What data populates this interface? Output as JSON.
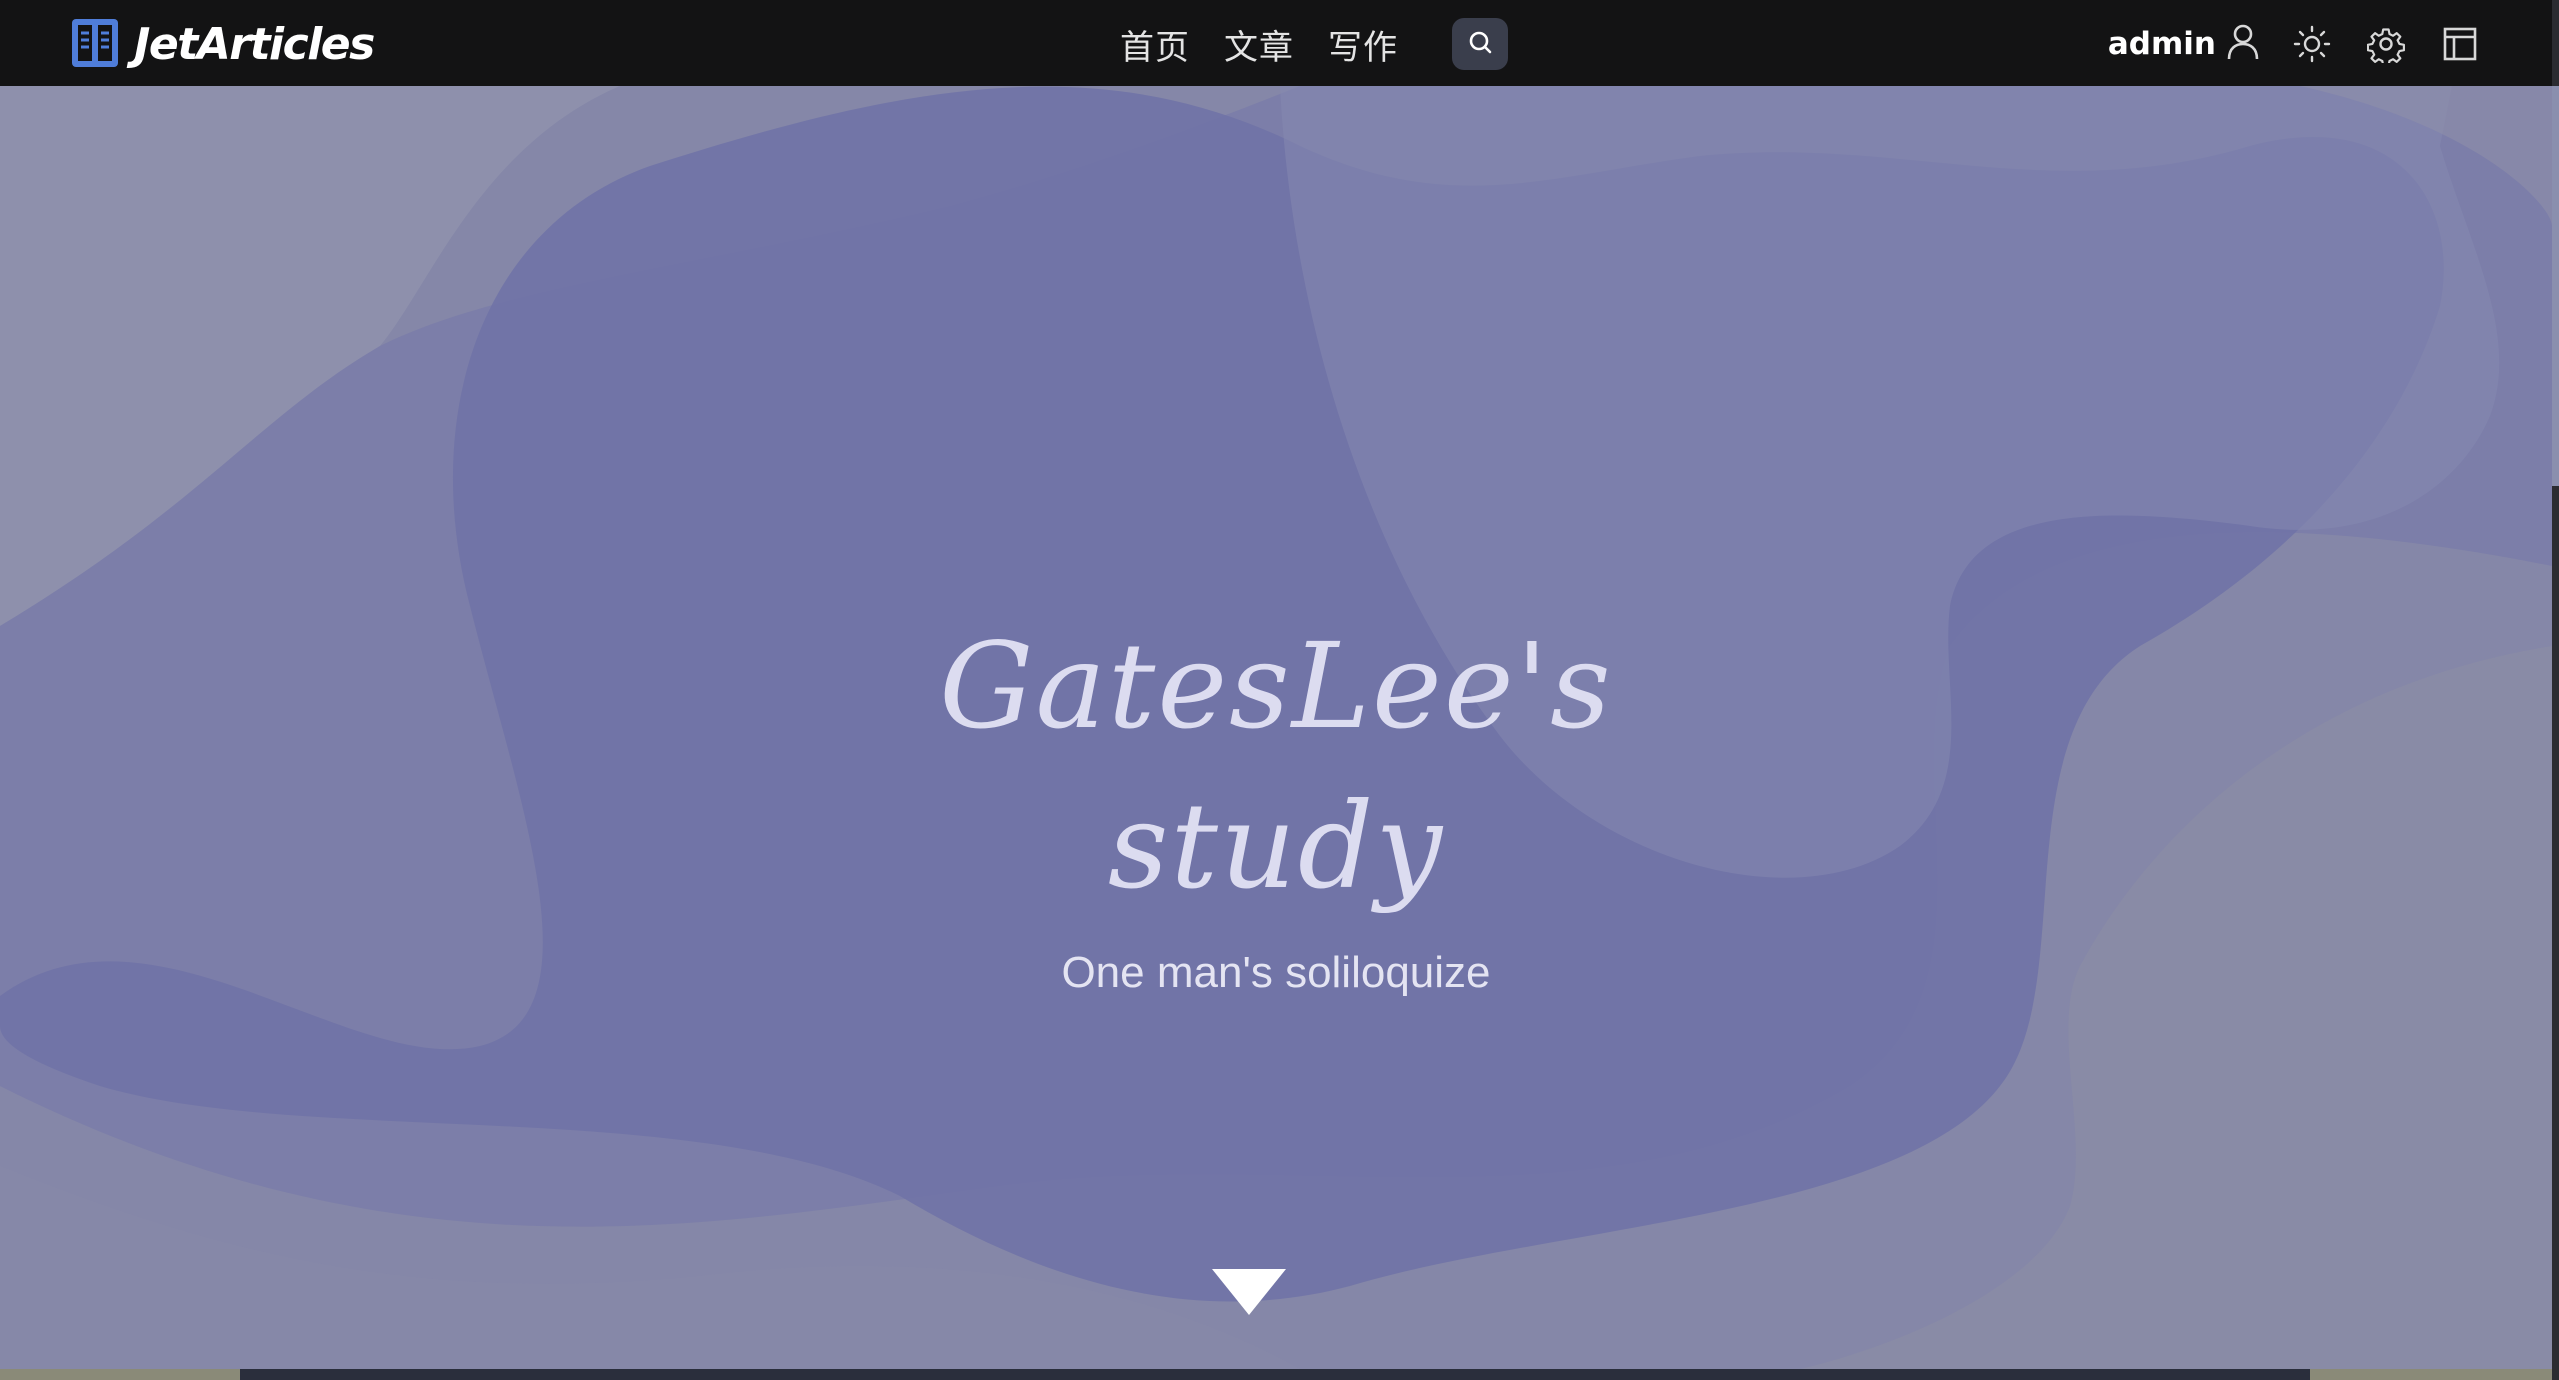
{
  "navbar": {
    "brand": {
      "name": "JetArticles",
      "icon": "book-icon"
    },
    "links": [
      {
        "label": "首页"
      },
      {
        "label": "文章"
      },
      {
        "label": "写作"
      }
    ],
    "search": {
      "icon": "search-icon"
    },
    "user": {
      "name": "admin",
      "icon": "user-icon"
    },
    "tools": [
      {
        "icon": "sun-icon"
      },
      {
        "icon": "gear-icon"
      },
      {
        "icon": "layout-panel-icon"
      }
    ]
  },
  "hero": {
    "title_line1": "GatesLee's",
    "title_line2": "study",
    "subtitle": "One man's soliloquize",
    "scroll_icon": "triangle-down-icon"
  },
  "colors": {
    "navbar_bg": "#131314",
    "hero_bg": "#7d80a8",
    "brand_icon": "#4f7dd9",
    "search_bg": "#3a3e4c"
  }
}
